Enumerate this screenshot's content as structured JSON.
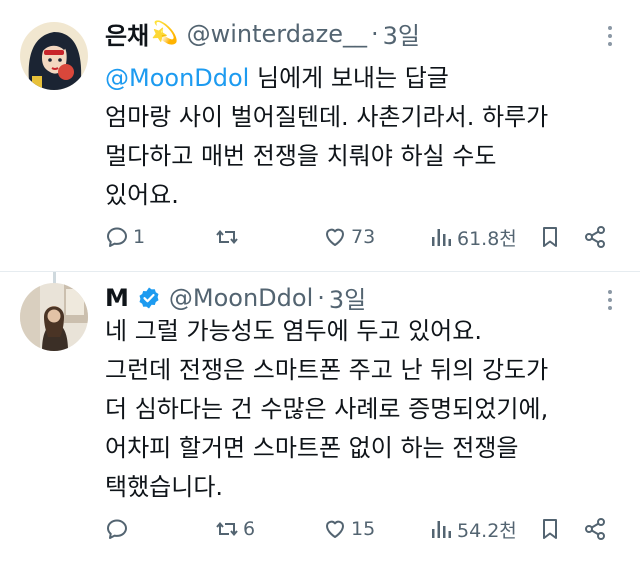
{
  "tweets": [
    {
      "display_name": "은채",
      "name_emoji": "💫",
      "handle": "@winterdaze__",
      "separator": "·",
      "time": "3일",
      "reply_to": {
        "mention": "@MoonDdol",
        "suffix": " 님에게 보내는 답글"
      },
      "text_lines": [
        "엄마랑 사이 벌어질텐데. 사촌기라서. 하루가",
        "멀다하고 매번 전쟁을 치뤄야 하실 수도",
        "있어요."
      ],
      "stats": {
        "replies": "1",
        "retweets": "",
        "likes": "73",
        "views": "61.8천"
      }
    },
    {
      "display_name": "M",
      "verified": true,
      "handle": "@MoonDdol",
      "separator": "·",
      "time": "3일",
      "text_lines": [
        "네 그럴 가능성도 염두에 두고 있어요.",
        "그런데 전쟁은 스마트폰 주고 난 뒤의 강도가",
        "더 심하다는 건 수많은 사례로 증명되었기에,",
        "어차피 할거면 스마트폰 없이 하는 전쟁을",
        "택했습니다."
      ],
      "stats": {
        "replies": "",
        "retweets": "6",
        "likes": "15",
        "views": "54.2천"
      }
    }
  ],
  "colors": {
    "text": "#0f1419",
    "secondary": "#536471",
    "link": "#1d9bf0",
    "verified": "#1d9bf0",
    "divider": "#e6ecf0"
  },
  "icons": [
    "comment-icon",
    "retweet-icon",
    "heart-icon",
    "views-icon",
    "bookmark-icon",
    "share-icon",
    "more-icon",
    "verified-icon"
  ]
}
